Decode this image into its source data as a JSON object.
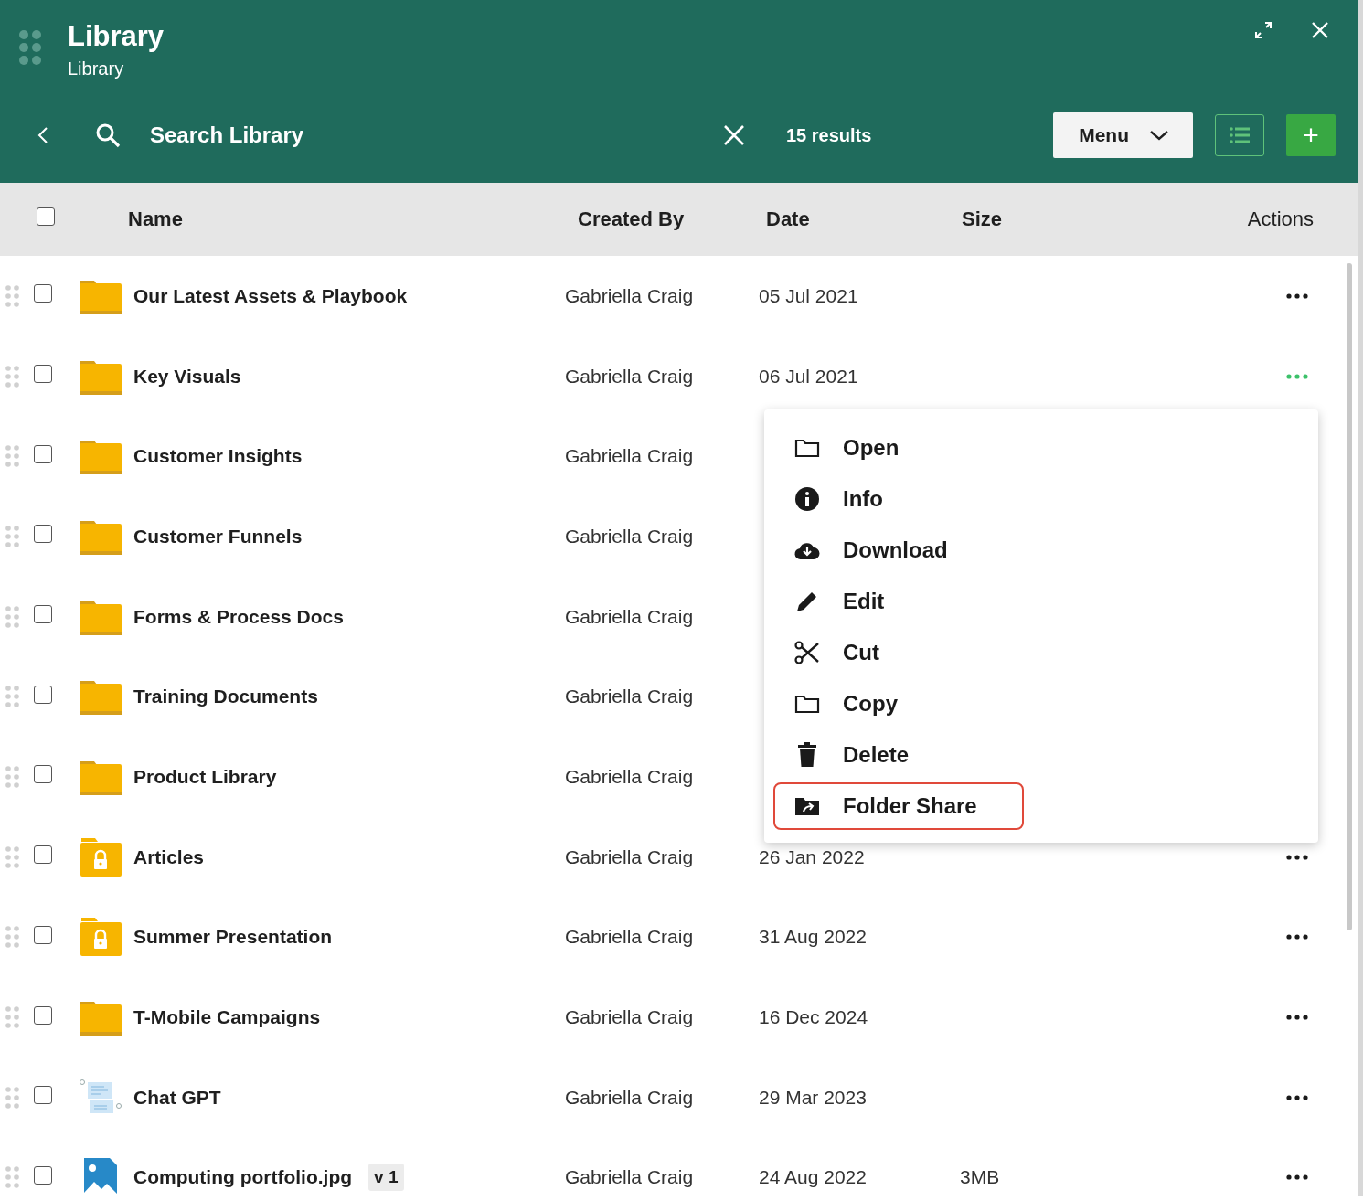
{
  "header": {
    "title": "Library",
    "subtitle": "Library"
  },
  "toolbar": {
    "search_value": "Search Library",
    "results": "15 results",
    "menu_button": "Menu",
    "add_button": "+"
  },
  "table": {
    "columns": [
      "Name",
      "Created By",
      "Date",
      "Size",
      "Actions"
    ],
    "all_checked": false,
    "rows": [
      {
        "kind": "folder",
        "name": "Our Latest Assets & Playbook",
        "created_by": "Gabriella Craig",
        "date": "05 Jul 2021",
        "checked": false,
        "active": false
      },
      {
        "kind": "folder",
        "name": "Key Visuals",
        "created_by": "Gabriella Craig",
        "date": "06 Jul 2021",
        "checked": false,
        "active": true
      },
      {
        "kind": "folder",
        "name": "Customer Insights",
        "created_by": "Gabriella Craig",
        "checked": false
      },
      {
        "kind": "folder",
        "name": "Customer Funnels",
        "created_by": "Gabriella Craig",
        "checked": false
      },
      {
        "kind": "folder",
        "name": "Forms & Process Docs",
        "created_by": "Gabriella Craig",
        "checked": false
      },
      {
        "kind": "folder",
        "name": "Training Documents",
        "created_by": "Gabriella Craig",
        "checked": false
      },
      {
        "kind": "folder",
        "name": "Product Library",
        "created_by": "Gabriella Craig",
        "checked": false
      },
      {
        "kind": "locked-folder",
        "name": "Articles",
        "created_by": "Gabriella Craig",
        "date": "26 Jan 2022",
        "checked": false,
        "active": false
      },
      {
        "kind": "locked-folder",
        "name": "Summer Presentation",
        "created_by": "Gabriella Craig",
        "date": "31 Aug 2022",
        "checked": false,
        "active": false
      },
      {
        "kind": "folder",
        "name": "T-Mobile Campaigns",
        "created_by": "Gabriella Craig",
        "date": "16 Dec 2024",
        "checked": false,
        "active": false
      },
      {
        "kind": "document",
        "name": "Chat GPT",
        "created_by": "Gabriella Craig",
        "date": "29 Mar 2023",
        "checked": false,
        "active": false
      },
      {
        "kind": "image",
        "name": "Computing portfolio.jpg",
        "version": "v 1",
        "created_by": "Gabriella Craig",
        "date": "24 Aug 2022",
        "size": "3MB",
        "checked": false,
        "active": false
      }
    ]
  },
  "context_menu": {
    "items": [
      {
        "kind": "open",
        "label": "Open",
        "selected": false
      },
      {
        "kind": "info",
        "label": "Info",
        "selected": false
      },
      {
        "kind": "download",
        "label": "Download",
        "selected": false
      },
      {
        "kind": "edit",
        "label": "Edit",
        "selected": false
      },
      {
        "kind": "cut",
        "label": "Cut",
        "selected": false
      },
      {
        "kind": "copy",
        "label": "Copy",
        "selected": false
      },
      {
        "kind": "delete",
        "label": "Delete",
        "selected": false
      },
      {
        "kind": "folder-share",
        "label": "Folder Share",
        "selected": true
      }
    ]
  }
}
